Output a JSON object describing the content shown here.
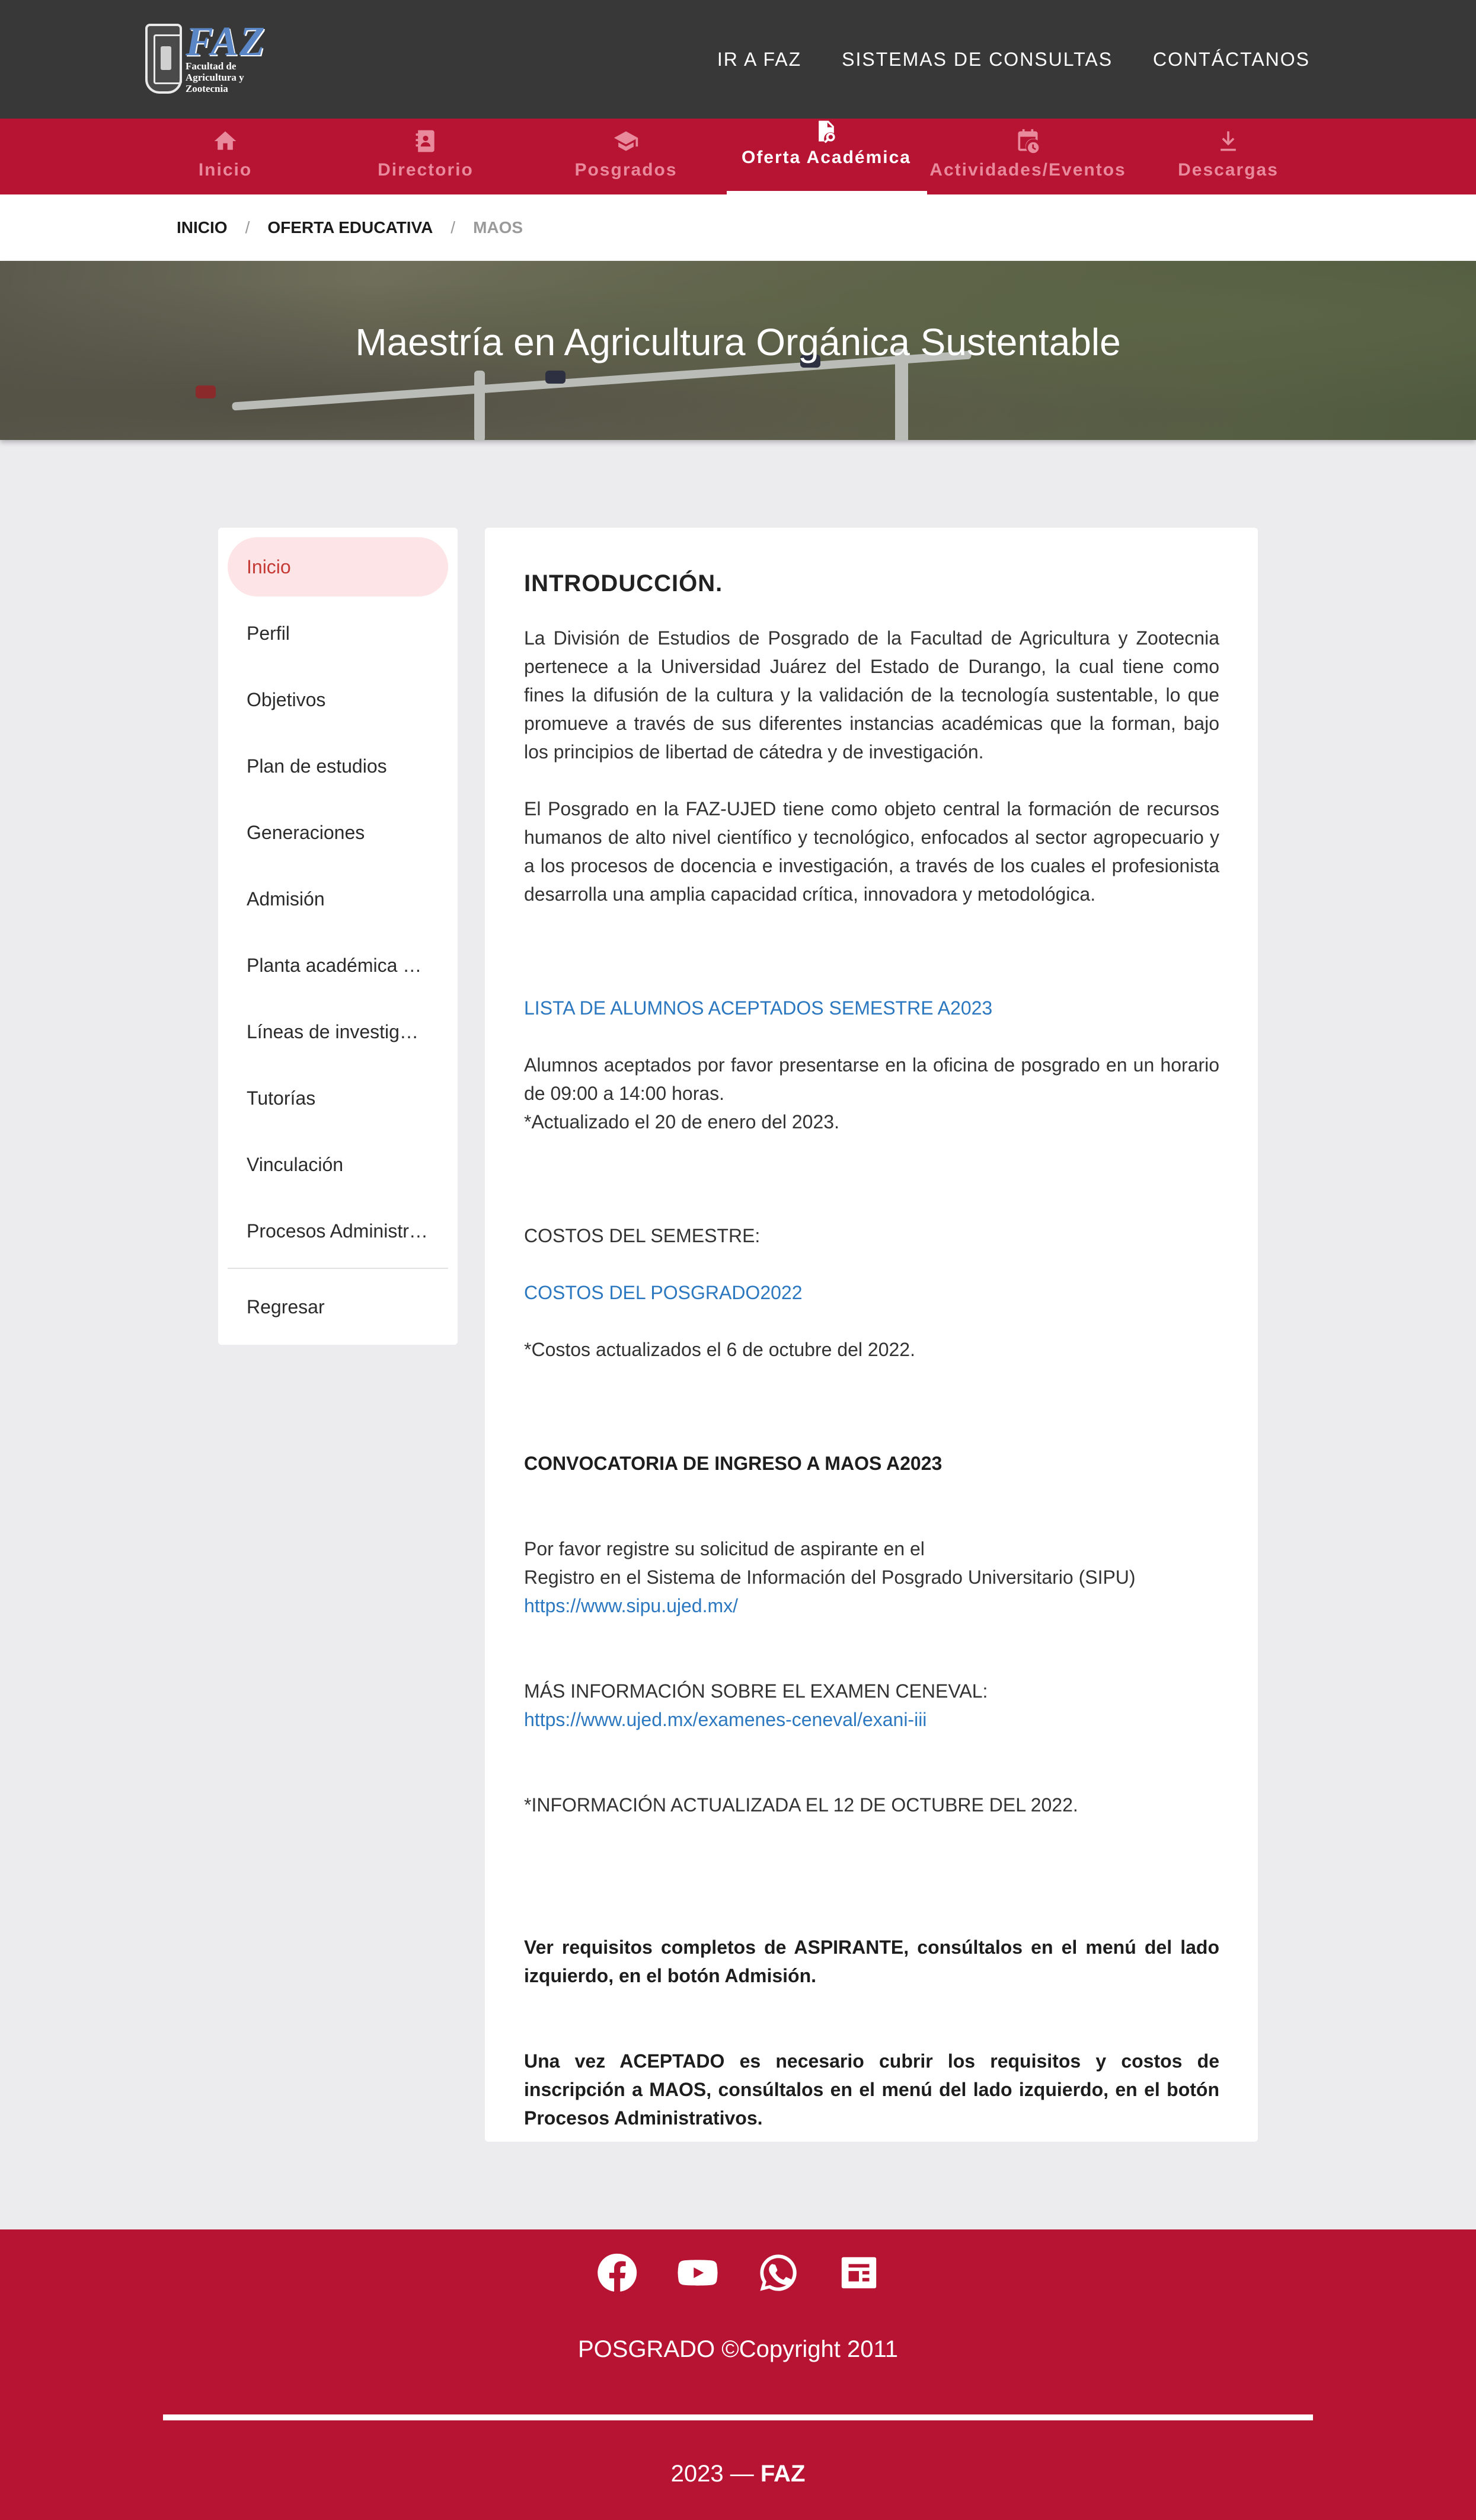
{
  "header": {
    "logo_text": "FAZ",
    "logo_subtext_1": "Facultad de",
    "logo_subtext_2": "Agricultura y Zootecnia",
    "links": [
      "IR A FAZ",
      "SISTEMAS DE CONSULTAS",
      "CONTÁCTANOS"
    ]
  },
  "nav": {
    "items": [
      {
        "label": "Inicio",
        "icon": "home-icon"
      },
      {
        "label": "Directorio",
        "icon": "address-book-icon"
      },
      {
        "label": "Posgrados",
        "icon": "graduation-cap-icon"
      },
      {
        "label": "Oferta Académica",
        "icon": "file-search-icon",
        "active": true
      },
      {
        "label": "Actividades/Eventos",
        "icon": "calendar-clock-icon"
      },
      {
        "label": "Descargas",
        "icon": "download-icon"
      }
    ]
  },
  "breadcrumb": {
    "home": "INICIO",
    "section": "OFERTA EDUCATIVA",
    "current": "MAOS",
    "separator": "/"
  },
  "hero": {
    "title": "Maestría en Agricultura Orgánica Sustentable"
  },
  "sidebar": {
    "items": [
      "Inicio",
      "Perfil",
      "Objetivos",
      "Plan de estudios",
      "Generaciones",
      "Admisión",
      "Planta académica …",
      "Líneas de investig…",
      "Tutorías",
      "Vinculación",
      "Procesos Administr…"
    ],
    "back": "Regresar"
  },
  "content": {
    "heading": "INTRODUCCIÓN.",
    "intro_1": "La División de Estudios de Posgrado de la Facultad de Agricultura y Zootecnia pertenece a la Universidad Juárez del Estado de Durango, la cual tiene como fines la difusión de la cultura y la validación de la tecnología sustentable, lo que promueve a través de sus diferentes instancias académicas que la forman, bajo los principios de libertad de cátedra y de investigación.",
    "intro_2": "El Posgrado en la FAZ-UJED tiene como objeto central la formación de recursos humanos de alto nivel científico y tecnológico, enfocados al sector agropecuario y a los procesos de docencia e investigación, a través de los cuales el profesionista desarrolla una amplia capacidad crítica, innovadora y metodológica.",
    "accepted_link": "LISTA DE ALUMNOS ACEPTADOS SEMESTRE A2023",
    "accepted_text": "Alumnos aceptados por favor presentarse en la oficina de posgrado en un horario de 09:00 a 14:00 horas.",
    "accepted_updated": "*Actualizado el 20 de enero del 2023.",
    "costs_heading": "COSTOS DEL SEMESTRE:",
    "costs_link": "COSTOS DEL POSGRADO2022",
    "costs_updated": "*Costos actualizados el 6 de octubre del 2022.",
    "call_heading": "CONVOCATORIA DE INGRESO A MAOS A2023",
    "register_1": "Por favor registre su solicitud de aspirante en el",
    "register_2": "Registro en el Sistema de Información del Posgrado Universitario (SIPU)",
    "sipu_link": "https://www.sipu.ujed.mx/",
    "ceneval_text": "MÁS INFORMACIÓN SOBRE EL EXAMEN CENEVAL:",
    "ceneval_link": "https://www.ujed.mx/examenes-ceneval/exani-iii",
    "info_updated": "*INFORMACIÓN ACTUALIZADA EL 12 DE OCTUBRE DEL 2022.",
    "requirements": "Ver requisitos completos de ASPIRANTE, consúltalos en el menú del lado izquierdo, en el botón Admisión.",
    "accepted_requirements": "Una vez ACEPTADO es necesario cubrir los requisitos y costos de inscripción a MAOS, consúltalos en el menú del lado izquierdo, en el botón Procesos Administrativos."
  },
  "footer": {
    "socials": [
      "facebook-icon",
      "youtube-icon",
      "whatsapp-icon",
      "newspaper-icon"
    ],
    "copyright": "POSGRADO ©Copyright 2011",
    "year_text": "2023 — ",
    "brand": "FAZ"
  },
  "colors": {
    "header_bg": "#383838",
    "brand_red": "#b71434",
    "link_blue": "#2c78c0",
    "active_item_bg": "#fde4e6",
    "active_item_text": "#c53a35"
  }
}
